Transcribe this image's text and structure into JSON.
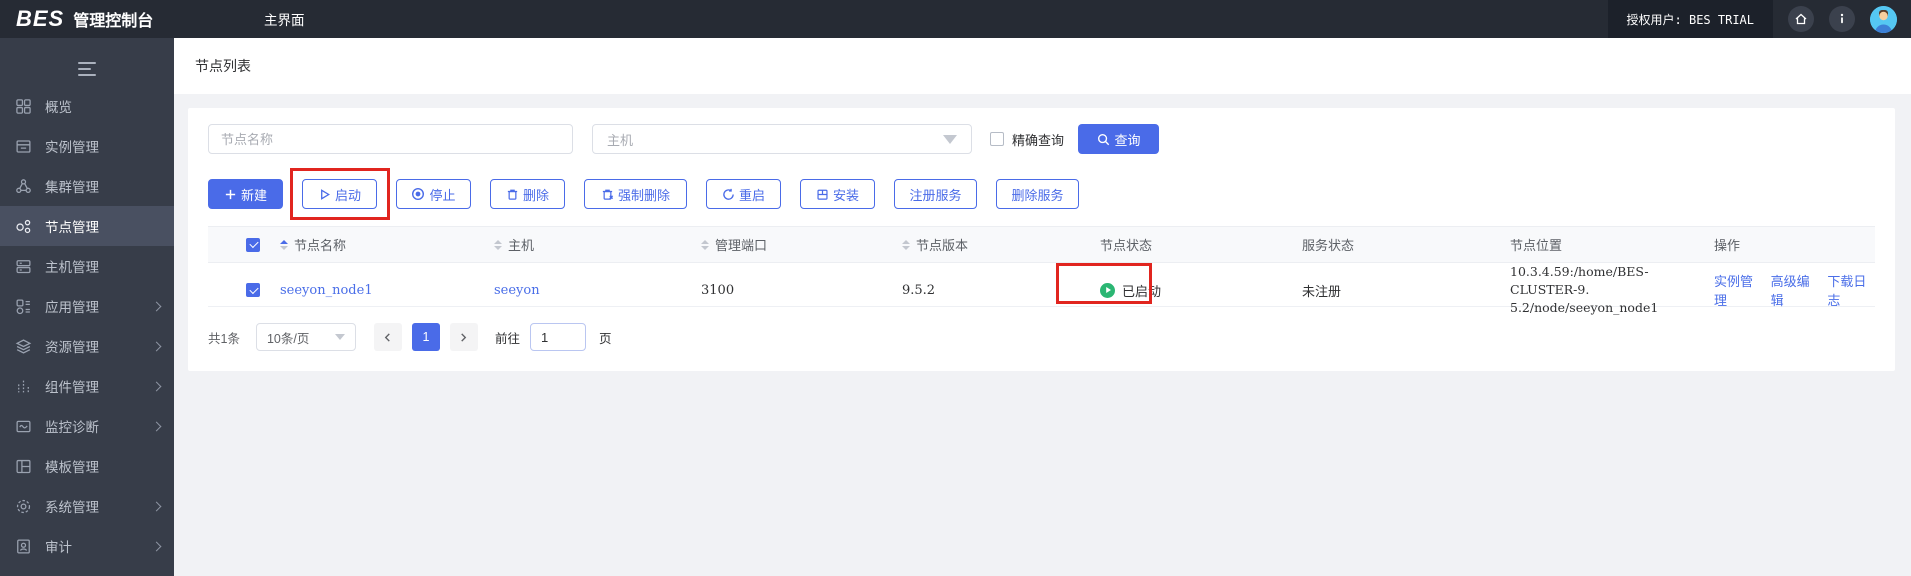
{
  "header": {
    "logo_primary": "BES",
    "logo_secondary": "管理控制台",
    "tab": "主界面",
    "license_label": "授权用户: BES TRIAL"
  },
  "sidebar": {
    "items": [
      {
        "label": "概览",
        "icon": "overview-grid-icon",
        "active": false,
        "expandable": false
      },
      {
        "label": "实例管理",
        "icon": "instance-box-icon",
        "active": false,
        "expandable": false
      },
      {
        "label": "集群管理",
        "icon": "cluster-icon",
        "active": false,
        "expandable": false
      },
      {
        "label": "节点管理",
        "icon": "node-icon",
        "active": true,
        "expandable": false
      },
      {
        "label": "主机管理",
        "icon": "host-icon",
        "active": false,
        "expandable": false
      },
      {
        "label": "应用管理",
        "icon": "app-icon",
        "active": false,
        "expandable": true
      },
      {
        "label": "资源管理",
        "icon": "resource-layers-icon",
        "active": false,
        "expandable": true
      },
      {
        "label": "组件管理",
        "icon": "component-icon",
        "active": false,
        "expandable": true
      },
      {
        "label": "监控诊断",
        "icon": "monitor-icon",
        "active": false,
        "expandable": true
      },
      {
        "label": "模板管理",
        "icon": "template-icon",
        "active": false,
        "expandable": false
      },
      {
        "label": "系统管理",
        "icon": "system-gear-icon",
        "active": false,
        "expandable": true
      },
      {
        "label": "审计",
        "icon": "audit-icon",
        "active": false,
        "expandable": true
      }
    ]
  },
  "page": {
    "title": "节点列表"
  },
  "filters": {
    "node_name_placeholder": "节点名称",
    "host_placeholder": "主机",
    "exact_query_label": "精确查询",
    "exact_query_checked": false,
    "search_button": "查询"
  },
  "toolbar": {
    "buttons": [
      {
        "label": "新建",
        "icon": "plus-icon",
        "type": "primary"
      },
      {
        "label": "启动",
        "icon": "play-icon",
        "type": "outline",
        "annotated": true
      },
      {
        "label": "停止",
        "icon": "stop-icon",
        "type": "outline"
      },
      {
        "label": "删除",
        "icon": "trash-icon",
        "type": "outline"
      },
      {
        "label": "强制删除",
        "icon": "trash-x-icon",
        "type": "outline"
      },
      {
        "label": "重启",
        "icon": "restart-icon",
        "type": "outline"
      },
      {
        "label": "安装",
        "icon": "install-icon",
        "type": "outline"
      },
      {
        "label": "注册服务",
        "icon": null,
        "type": "outline"
      },
      {
        "label": "删除服务",
        "icon": null,
        "type": "outline"
      }
    ]
  },
  "table": {
    "columns": [
      {
        "label": "节点名称",
        "sortable": true
      },
      {
        "label": "主机",
        "sortable": true
      },
      {
        "label": "管理端口",
        "sortable": true
      },
      {
        "label": "节点版本",
        "sortable": true
      },
      {
        "label": "节点状态",
        "sortable": false
      },
      {
        "label": "服务状态",
        "sortable": false
      },
      {
        "label": "节点位置",
        "sortable": false
      },
      {
        "label": "操作",
        "sortable": false
      }
    ],
    "rows": [
      {
        "checked": true,
        "node_name": "seeyon_node1",
        "host": "seeyon",
        "admin_port": "3100",
        "node_version": "9.5.2",
        "node_status": "已启动",
        "service_status": "未注册",
        "node_location_line1": "10.3.4.59:/home/BES-CLUSTER-9.",
        "node_location_line2": "5.2/node/seeyon_node1",
        "actions": [
          "实例管理",
          "高级编辑",
          "下载日志"
        ]
      }
    ]
  },
  "pagination": {
    "total_label": "共1条",
    "page_size": "10条/页",
    "prev_icon": "chevron-left-icon",
    "current_page": "1",
    "next_icon": "chevron-right-icon",
    "goto_label": "前往",
    "goto_value": "1",
    "page_unit": "页"
  },
  "colors": {
    "accent_blue": "#4a6be8",
    "status_green": "#2bb673",
    "annotation_red": "#e1251f",
    "header_dark": "#262b34",
    "sidebar_dark": "#373d49"
  }
}
